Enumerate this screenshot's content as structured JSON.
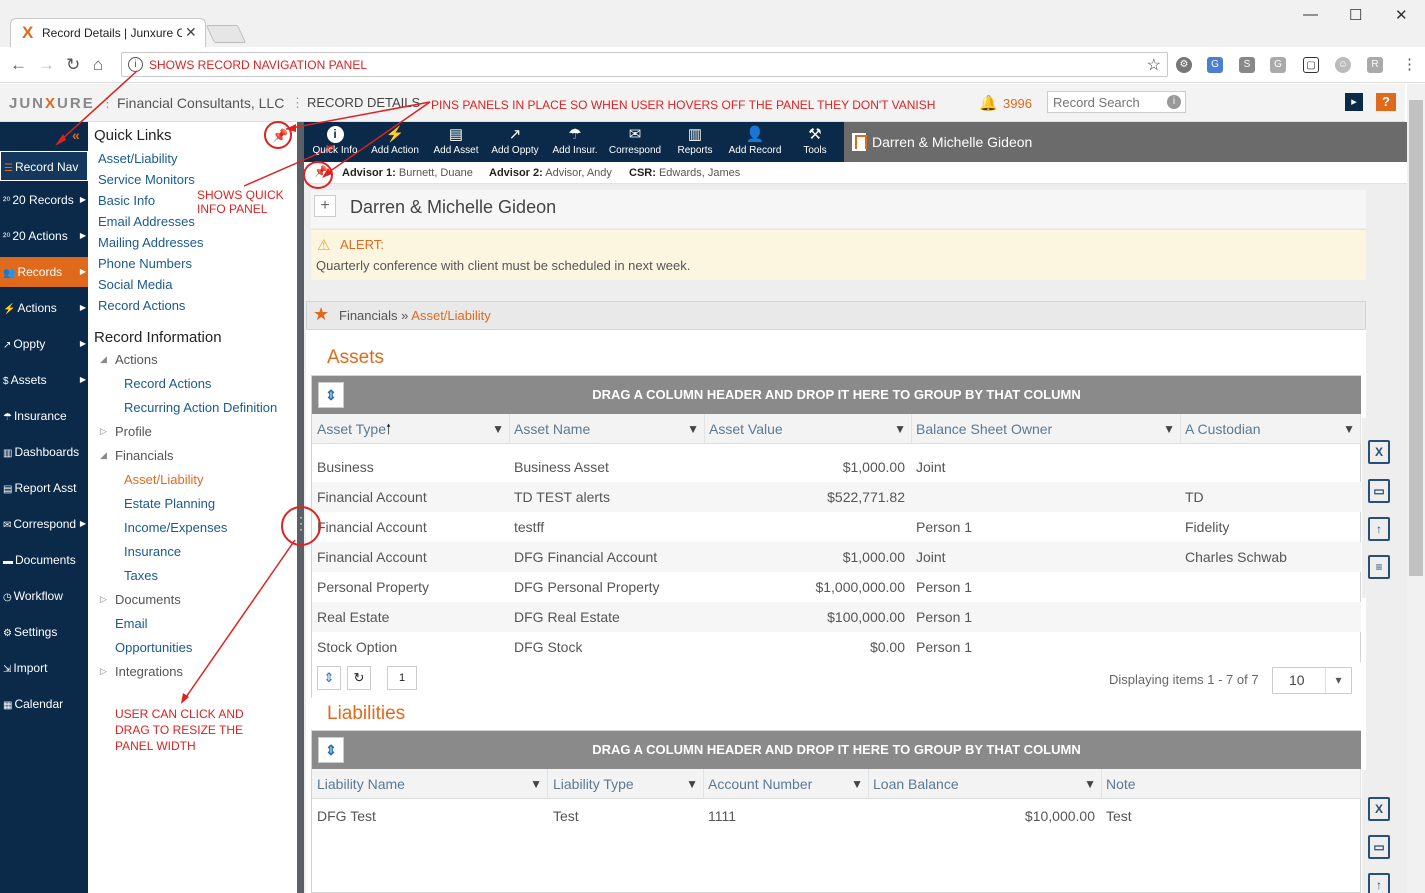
{
  "browser": {
    "tab_title": "Record Details | Junxure C",
    "address_annotation": "SHOWS RECORD NAVIGATION PANEL"
  },
  "header": {
    "logo": "JUNXURE",
    "company": "Financial Consultants, LLC",
    "section": "RECORD DETAILS",
    "notifications": "3996",
    "search_placeholder": "Record Search"
  },
  "leftnav": {
    "items": [
      {
        "label": "Record Nav",
        "icon": "menu-icon"
      },
      {
        "label": "20 Records",
        "icon": "twenty-icon"
      },
      {
        "label": "20 Actions",
        "icon": "twenty-icon"
      },
      {
        "label": "Records",
        "icon": "people-icon"
      },
      {
        "label": "Actions",
        "icon": "lightning-icon"
      },
      {
        "label": "Oppty",
        "icon": "chart-icon"
      },
      {
        "label": "Assets",
        "icon": "dollar-icon"
      },
      {
        "label": "Insurance",
        "icon": "umbrella-icon"
      },
      {
        "label": "Dashboards",
        "icon": "bars-icon"
      },
      {
        "label": "Report Asst",
        "icon": "report-icon"
      },
      {
        "label": "Correspond",
        "icon": "envelope-icon"
      },
      {
        "label": "Documents",
        "icon": "folder-icon"
      },
      {
        "label": "Workflow",
        "icon": "clock-icon"
      },
      {
        "label": "Settings",
        "icon": "gear-icon"
      },
      {
        "label": "Import",
        "icon": "import-icon"
      },
      {
        "label": "Calendar",
        "icon": "calendar-icon"
      }
    ]
  },
  "quicklinks": {
    "title": "Quick Links",
    "links": [
      "Asset/Liability",
      "Service Monitors",
      "Basic Info",
      "Email Addresses",
      "Mailing Addresses",
      "Phone Numbers",
      "Social Media",
      "Record Actions"
    ],
    "info_title": "Record Information",
    "tree": {
      "actions": "Actions",
      "record_actions": "Record Actions",
      "recurring": "Recurring Action Definition",
      "profile": "Profile",
      "financials": "Financials",
      "asset_liability": "Asset/Liability",
      "estate": "Estate Planning",
      "income": "Income/Expenses",
      "insurance": "Insurance",
      "taxes": "Taxes",
      "documents": "Documents",
      "email": "Email",
      "opportunities": "Opportunities",
      "integrations": "Integrations"
    }
  },
  "toolbar": {
    "buttons": [
      "Quick Info",
      "Add Action",
      "Add Asset",
      "Add Oppty",
      "Add Insur.",
      "Correspond",
      "Reports",
      "Add Record",
      "Tools"
    ],
    "record_name": "Darren & Michelle Gideon"
  },
  "advisors": {
    "a1_label": "Advisor 1:",
    "a1": "Burnett, Duane",
    "a2_label": "Advisor 2:",
    "a2": "Advisor, Andy",
    "csr_label": "CSR:",
    "csr": "Edwards, James"
  },
  "client": {
    "name": "Darren & Michelle Gideon",
    "alert_title": "ALERT:",
    "alert_msg": "Quarterly conference with client must be scheduled in next week."
  },
  "breadcrumb": {
    "parent": "Financials",
    "sep": "»",
    "current": "Asset/Liability"
  },
  "assets": {
    "title": "Assets",
    "group_hint": "DRAG A COLUMN HEADER AND DROP IT HERE TO GROUP BY THAT COLUMN",
    "columns": [
      "Asset Type",
      "Asset Name",
      "Asset Value",
      "Balance Sheet Owner",
      "A Custodian"
    ],
    "rows": [
      [
        "Business",
        "Business Asset",
        "$1,000.00",
        "Joint",
        ""
      ],
      [
        "Financial Account",
        "TD TEST alerts",
        "$522,771.82",
        "",
        "TD"
      ],
      [
        "Financial Account",
        "testff",
        "",
        "Person 1",
        "Fidelity"
      ],
      [
        "Financial Account",
        "DFG Financial Account",
        "$1,000.00",
        "Joint",
        "Charles Schwab"
      ],
      [
        "Personal Property",
        "DFG Personal Property",
        "$1,000,000.00",
        "Person 1",
        ""
      ],
      [
        "Real Estate",
        "DFG Real Estate",
        "$100,000.00",
        "Person 1",
        ""
      ],
      [
        "Stock Option",
        "DFG Stock",
        "$0.00",
        "Person 1",
        ""
      ]
    ],
    "page": "1",
    "display": "Displaying items 1 - 7 of 7",
    "page_size": "10"
  },
  "liabilities": {
    "title": "Liabilities",
    "group_hint": "DRAG A COLUMN HEADER AND DROP IT HERE TO GROUP BY THAT COLUMN",
    "columns": [
      "Liability Name",
      "Liability Type",
      "Account Number",
      "Loan Balance",
      "Note"
    ],
    "rows": [
      [
        "DFG Test",
        "Test",
        "1111",
        "$10,000.00",
        "Test"
      ]
    ]
  },
  "annotations": {
    "pins": "PINS PANELS IN PLACE SO WHEN USER HOVERS OFF THE PANEL THEY DON'T VANISH",
    "quickinfo_1": "SHOWS QUICK",
    "quickinfo_2": "INFO PANEL",
    "resize_1": "USER CAN CLICK AND",
    "resize_2": "DRAG TO RESIZE THE",
    "resize_3": "PANEL WIDTH"
  },
  "colors": {
    "accent": "#e06a1b",
    "nav": "#0b2a4a",
    "annotation": "#dd2222"
  }
}
